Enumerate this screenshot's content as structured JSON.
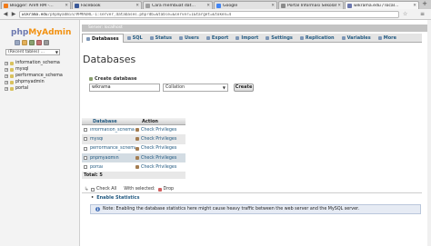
{
  "browser": {
    "tabs": [
      {
        "label": "Blogger: ArefI RM -…",
        "color": "#f07b1a",
        "active": false
      },
      {
        "label": "Facebook",
        "color": "#3b5998",
        "active": false
      },
      {
        "label": "Cara membuat dat…",
        "color": "#a0a0a0",
        "active": false
      },
      {
        "label": "Google",
        "color": "#4285f4",
        "active": false
      },
      {
        "label": "Portal Informasi Sekolah",
        "color": "#8b8b8b",
        "active": false
      },
      {
        "label": "wikrama.edu / local…",
        "color": "#6c78af",
        "active": true
      }
    ],
    "url_host": "wikrama.edu",
    "url_path": "/phpmyadmin/#PMAURL-1:server_databases.php?db=&table=&server=1&target=&token=4"
  },
  "pma": {
    "logo_php": "php",
    "logo_my": "My",
    "logo_admin": "Admin",
    "recent_label": "(Recent tables) ...",
    "databases": [
      "information_schema",
      "mysql",
      "performance_schema",
      "phpmyadmin",
      "portal"
    ],
    "server_bar": "Server: localhost",
    "tabs": [
      {
        "label": "Databases",
        "active": true
      },
      {
        "label": "SQL",
        "active": false
      },
      {
        "label": "Status",
        "active": false
      },
      {
        "label": "Users",
        "active": false
      },
      {
        "label": "Export",
        "active": false
      },
      {
        "label": "Import",
        "active": false
      },
      {
        "label": "Settings",
        "active": false
      },
      {
        "label": "Replication",
        "active": false
      },
      {
        "label": "Variables",
        "active": false
      },
      {
        "label": "More",
        "active": false
      }
    ],
    "page_title": "Databases",
    "create_label": "Create database",
    "create_input_value": "wikrama",
    "collation_placeholder": "Collation",
    "create_button": "Create",
    "table_headers": {
      "database": "Database",
      "action": "Action"
    },
    "rows": [
      {
        "name": "information_schema",
        "action": "Check Privileges"
      },
      {
        "name": "mysql",
        "action": "Check Privileges"
      },
      {
        "name": "performance_schema",
        "action": "Check Privileges"
      },
      {
        "name": "phpmyadmin",
        "action": "Check Privileges"
      },
      {
        "name": "portal",
        "action": "Check Privileges"
      }
    ],
    "total_label": "Total: 5",
    "check_all": "Check All",
    "with_selected": "With selected:",
    "drop_label": "Drop",
    "enable_stats": "Enable Statistics",
    "notice": "Note: Enabling the database statistics here might cause heavy traffic between the web server and the MySQL server."
  }
}
